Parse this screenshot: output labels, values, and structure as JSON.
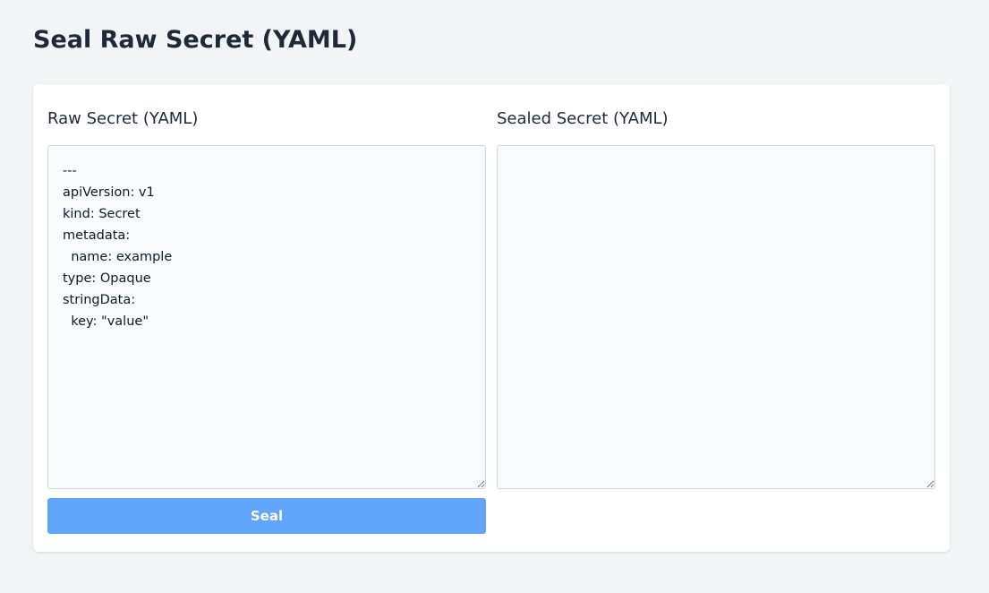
{
  "page": {
    "title": "Seal Raw Secret (YAML)"
  },
  "raw_panel": {
    "label": "Raw Secret (YAML)",
    "value": "---\napiVersion: v1\nkind: Secret\nmetadata:\n  name: example\ntype: Opaque\nstringData:\n  key: \"value\""
  },
  "sealed_panel": {
    "label": "Sealed Secret (YAML)",
    "value": ""
  },
  "actions": {
    "seal_label": "Seal"
  },
  "colors": {
    "background": "#f3f4f6",
    "card": "#ffffff",
    "textarea_bg": "#f9fafb",
    "button": "#60a5fa"
  }
}
